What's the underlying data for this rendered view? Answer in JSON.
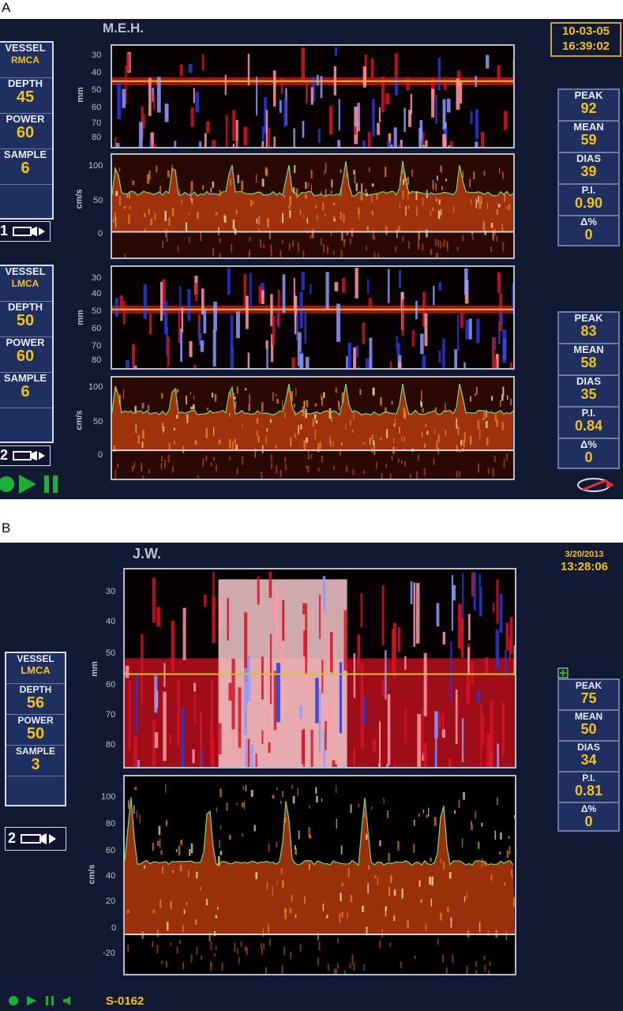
{
  "figure": {
    "label_a": "A",
    "label_b": "B"
  },
  "panel_a": {
    "patient": "M.E.H.",
    "date": "10-03-05",
    "time": "16:39:02",
    "channel1": {
      "vessel_label": "VESSEL",
      "vessel": "RMCA",
      "depth_label": "DEPTH",
      "depth": "45",
      "power_label": "POWER",
      "power": "60",
      "sample_label": "SAMPLE",
      "sample": "6",
      "probe": "1",
      "stats": {
        "peak_label": "PEAK",
        "peak": "92",
        "mean_label": "MEAN",
        "mean": "59",
        "dias_label": "DIAS",
        "dias": "39",
        "pi_label": "P.I.",
        "pi": "0.90",
        "delta_label": "Δ%",
        "delta": "0"
      }
    },
    "channel2": {
      "vessel_label": "VESSEL",
      "vessel": "LMCA",
      "depth_label": "DEPTH",
      "depth": "50",
      "power_label": "POWER",
      "power": "60",
      "sample_label": "SAMPLE",
      "sample": "6",
      "probe": "2",
      "stats": {
        "peak_label": "PEAK",
        "peak": "83",
        "mean_label": "MEAN",
        "mean": "58",
        "dias_label": "DIAS",
        "dias": "35",
        "pi_label": "P.I.",
        "pi": "0.84",
        "delta_label": "Δ%",
        "delta": "0"
      }
    },
    "mm_axis_label": "mm",
    "mm_ticks": [
      "30",
      "40",
      "50",
      "60",
      "70",
      "80"
    ],
    "vel_axis_label": "cm/s",
    "vel_ticks": [
      "100",
      "50",
      "0"
    ]
  },
  "panel_b": {
    "patient": "J.W.",
    "date": "3/20/2013",
    "time": "13:28:06",
    "channel": {
      "vessel_label": "VESSEL",
      "vessel": "LMCA",
      "depth_label": "DEPTH",
      "depth": "56",
      "power_label": "POWER",
      "power": "50",
      "sample_label": "SAMPLE",
      "sample": "3",
      "probe": "2"
    },
    "stats": {
      "peak_label": "PEAK",
      "peak": "75",
      "mean_label": "MEAN",
      "mean": "50",
      "dias_label": "DIAS",
      "dias": "34",
      "pi_label": "P.I.",
      "pi": "0.81",
      "delta_label": "Δ%",
      "delta": "0"
    },
    "mm_axis_label": "mm",
    "mm_ticks": [
      "30",
      "40",
      "50",
      "60",
      "70",
      "80"
    ],
    "vel_axis_label": "cm/s",
    "vel_ticks": [
      "100",
      "80",
      "60",
      "40",
      "20",
      "0",
      "-20"
    ],
    "study_id": "S-0162"
  },
  "colors": {
    "accent": "#f2c21a",
    "panel_bg": "#121a33",
    "side_bg": "#1f2f60",
    "gate_line": "#d6c22a",
    "envelope": "#7fd67a",
    "controls": "#1fae3a"
  },
  "icons": [
    "probe-icon",
    "play-icon",
    "pause-icon",
    "record-icon",
    "speaker-icon",
    "logo-icon"
  ]
}
